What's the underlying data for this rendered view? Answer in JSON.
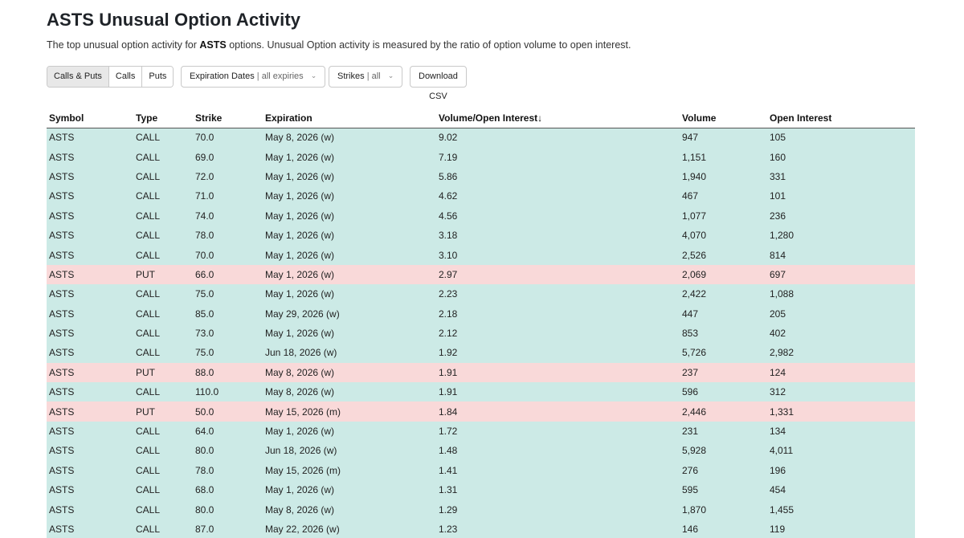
{
  "page": {
    "title": "ASTS Unusual Option Activity",
    "subtitle_prefix": "The top unusual option activity for ",
    "subtitle_ticker": "ASTS",
    "subtitle_suffix": " options. Unusual Option activity is measured by the ratio of option volume to open interest."
  },
  "filters": {
    "type_options": [
      "Calls & Puts",
      "Calls",
      "Puts"
    ],
    "type_selected": "Calls & Puts",
    "expiration_label": "Expiration Dates",
    "expiration_value": "all expiries",
    "strikes_label": "Strikes",
    "strikes_value": "all",
    "download_label": "Download CSV",
    "separator": "|",
    "chevron_icon": "chevron-down-icon"
  },
  "table": {
    "headers": [
      "Symbol",
      "Type",
      "Strike",
      "Expiration",
      "Volume/Open Interest↓",
      "Volume",
      "Open Interest"
    ],
    "call_color": "#cceae6",
    "put_color": "#f9d9d9",
    "rows": [
      [
        "ASTS",
        "CALL",
        "70.0",
        "May 8, 2026 (w)",
        "9.02",
        "947",
        "105"
      ],
      [
        "ASTS",
        "CALL",
        "69.0",
        "May 1, 2026 (w)",
        "7.19",
        "1,151",
        "160"
      ],
      [
        "ASTS",
        "CALL",
        "72.0",
        "May 1, 2026 (w)",
        "5.86",
        "1,940",
        "331"
      ],
      [
        "ASTS",
        "CALL",
        "71.0",
        "May 1, 2026 (w)",
        "4.62",
        "467",
        "101"
      ],
      [
        "ASTS",
        "CALL",
        "74.0",
        "May 1, 2026 (w)",
        "4.56",
        "1,077",
        "236"
      ],
      [
        "ASTS",
        "CALL",
        "78.0",
        "May 1, 2026 (w)",
        "3.18",
        "4,070",
        "1,280"
      ],
      [
        "ASTS",
        "CALL",
        "70.0",
        "May 1, 2026 (w)",
        "3.10",
        "2,526",
        "814"
      ],
      [
        "ASTS",
        "PUT",
        "66.0",
        "May 1, 2026 (w)",
        "2.97",
        "2,069",
        "697"
      ],
      [
        "ASTS",
        "CALL",
        "75.0",
        "May 1, 2026 (w)",
        "2.23",
        "2,422",
        "1,088"
      ],
      [
        "ASTS",
        "CALL",
        "85.0",
        "May 29, 2026 (w)",
        "2.18",
        "447",
        "205"
      ],
      [
        "ASTS",
        "CALL",
        "73.0",
        "May 1, 2026 (w)",
        "2.12",
        "853",
        "402"
      ],
      [
        "ASTS",
        "CALL",
        "75.0",
        "Jun 18, 2026 (w)",
        "1.92",
        "5,726",
        "2,982"
      ],
      [
        "ASTS",
        "PUT",
        "88.0",
        "May 8, 2026 (w)",
        "1.91",
        "237",
        "124"
      ],
      [
        "ASTS",
        "CALL",
        "110.0",
        "May 8, 2026 (w)",
        "1.91",
        "596",
        "312"
      ],
      [
        "ASTS",
        "PUT",
        "50.0",
        "May 15, 2026 (m)",
        "1.84",
        "2,446",
        "1,331"
      ],
      [
        "ASTS",
        "CALL",
        "64.0",
        "May 1, 2026 (w)",
        "1.72",
        "231",
        "134"
      ],
      [
        "ASTS",
        "CALL",
        "80.0",
        "Jun 18, 2026 (w)",
        "1.48",
        "5,928",
        "4,011"
      ],
      [
        "ASTS",
        "CALL",
        "78.0",
        "May 15, 2026 (m)",
        "1.41",
        "276",
        "196"
      ],
      [
        "ASTS",
        "CALL",
        "68.0",
        "May 1, 2026 (w)",
        "1.31",
        "595",
        "454"
      ],
      [
        "ASTS",
        "CALL",
        "80.0",
        "May 8, 2026 (w)",
        "1.29",
        "1,870",
        "1,455"
      ],
      [
        "ASTS",
        "CALL",
        "87.0",
        "May 22, 2026 (w)",
        "1.23",
        "146",
        "119"
      ]
    ]
  }
}
